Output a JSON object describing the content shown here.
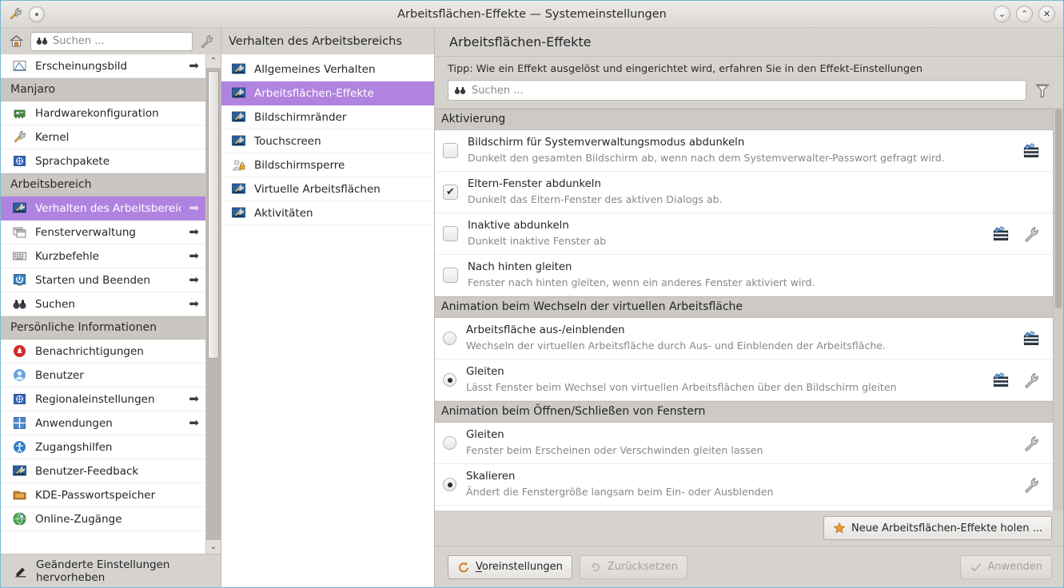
{
  "window": {
    "title": "Arbeitsflächen-Effekte — Systemeinstellungen",
    "minimize_label": "⌄",
    "maximize_label": "⌃",
    "close_label": "✕",
    "accent_color": "#b183e0",
    "window_bg": "#d6d2ce"
  },
  "sidebar": {
    "search": {
      "placeholder": "Suchen ...",
      "value": ""
    },
    "home_icon": "home-icon",
    "configure_icon": "wrench-icon",
    "top_item": {
      "label": "Erscheinungsbild",
      "icon": "appearance-icon",
      "has_arrow": true
    },
    "groups": [
      {
        "title": "Manjaro",
        "items": [
          {
            "label": "Hardwarekonfiguration",
            "icon": "hardware-icon",
            "has_arrow": false
          },
          {
            "label": "Kernel",
            "icon": "kernel-icon",
            "has_arrow": false
          },
          {
            "label": "Sprachpakete",
            "icon": "language-icon",
            "has_arrow": false
          }
        ]
      },
      {
        "title": "Arbeitsbereich",
        "items": [
          {
            "label": "Verhalten des Arbeitsbereichs",
            "icon": "workspace-icon",
            "has_arrow": true,
            "selected": true
          },
          {
            "label": "Fensterverwaltung",
            "icon": "window-icon",
            "has_arrow": true
          },
          {
            "label": "Kurzbefehle",
            "icon": "keyboard-icon",
            "has_arrow": true
          },
          {
            "label": "Starten und Beenden",
            "icon": "power-icon",
            "has_arrow": true
          },
          {
            "label": "Suchen",
            "icon": "search-icon",
            "has_arrow": true
          }
        ]
      },
      {
        "title": "Persönliche Informationen",
        "items": [
          {
            "label": "Benachrichtigungen",
            "icon": "bell-icon",
            "has_arrow": false
          },
          {
            "label": "Benutzer",
            "icon": "user-icon",
            "has_arrow": false
          },
          {
            "label": "Regionaleinstellungen",
            "icon": "globe-icon",
            "has_arrow": true
          },
          {
            "label": "Anwendungen",
            "icon": "applications-icon",
            "has_arrow": true
          },
          {
            "label": "Zugangshilfen",
            "icon": "accessibility-icon",
            "has_arrow": false
          },
          {
            "label": "Benutzer-Feedback",
            "icon": "feedback-icon",
            "has_arrow": false
          },
          {
            "label": "KDE-Passwortspeicher",
            "icon": "wallet-icon",
            "has_arrow": false
          },
          {
            "label": "Online-Zugänge",
            "icon": "online-accounts-icon",
            "has_arrow": false
          }
        ]
      }
    ],
    "footer": {
      "label": "Geänderte Einstellungen hervorheben",
      "icon": "highlight-pen-icon"
    }
  },
  "middle": {
    "header": "Verhalten des Arbeitsbereichs",
    "items": [
      {
        "label": "Allgemeines Verhalten",
        "icon": "workspace-icon",
        "selected": false
      },
      {
        "label": "Arbeitsflächen-Effekte",
        "icon": "workspace-icon",
        "selected": true
      },
      {
        "label": "Bildschirmränder",
        "icon": "workspace-icon",
        "selected": false
      },
      {
        "label": "Touchscreen",
        "icon": "workspace-icon",
        "selected": false
      },
      {
        "label": "Bildschirmsperre",
        "icon": "screenlock-icon",
        "selected": false
      },
      {
        "label": "Virtuelle Arbeitsflächen",
        "icon": "workspace-icon",
        "selected": false
      },
      {
        "label": "Aktivitäten",
        "icon": "workspace-icon",
        "selected": false
      }
    ]
  },
  "main": {
    "title": "Arbeitsflächen-Effekte",
    "tip": "Tipp: Wie ein Effekt ausgelöst und eingerichtet wird, erfahren Sie in den Effekt-Einstellungen",
    "search": {
      "placeholder": "Suchen ...",
      "value": ""
    },
    "filter_icon": "filter-funnel-icon",
    "sections": [
      {
        "title": "Aktivierung",
        "control_type": "checkbox",
        "rows": [
          {
            "title": "Bildschirm für Systemverwaltungsmodus abdunkeln",
            "desc": "Dunkelt den gesamten Bildschirm ab, wenn nach dem Systemverwalter-Passwort gefragt wird.",
            "checked": false,
            "actions": [
              "video-icon"
            ]
          },
          {
            "title": "Eltern-Fenster abdunkeln",
            "desc": "Dunkelt das Eltern-Fenster des aktiven Dialogs ab.",
            "checked": true,
            "actions": []
          },
          {
            "title": "Inaktive abdunkeln",
            "desc": "Dunkelt inaktive Fenster ab",
            "checked": false,
            "actions": [
              "video-icon",
              "wrench-icon"
            ]
          },
          {
            "title": "Nach hinten gleiten",
            "desc": "Fenster nach hinten gleiten, wenn ein anderes Fenster aktiviert wird.",
            "checked": false,
            "actions": []
          }
        ]
      },
      {
        "title": "Animation beim Wechseln der virtuellen Arbeitsfläche",
        "control_type": "radio",
        "rows": [
          {
            "title": "Arbeitsfläche aus-/einblenden",
            "desc": "Wechseln der virtuellen Arbeitsfläche durch Aus- und Einblenden der Arbeitsfläche.",
            "checked": false,
            "actions": [
              "video-icon"
            ]
          },
          {
            "title": "Gleiten",
            "desc": "Lässt Fenster beim Wechsel von virtuellen Arbeitsflächen über den Bildschirm gleiten",
            "checked": true,
            "actions": [
              "video-icon",
              "wrench-icon"
            ]
          }
        ]
      },
      {
        "title": "Animation beim Öffnen/Schließen von Fenstern",
        "control_type": "radio",
        "rows": [
          {
            "title": "Gleiten",
            "desc": "Fenster beim Erscheinen oder Verschwinden gleiten lassen",
            "checked": false,
            "actions": [
              "wrench-icon"
            ]
          },
          {
            "title": "Skalieren",
            "desc": "Ändert die Fenstergröße langsam beim Ein- oder Ausblenden",
            "checked": true,
            "actions": [
              "wrench-icon"
            ]
          }
        ]
      }
    ],
    "get_new_button": {
      "label": "Neue Arbeitsflächen-Effekte holen ...",
      "icon": "star-icon"
    }
  },
  "footer": {
    "defaults_button": {
      "label": "Voreinstellungen",
      "icon": "defaults-icon",
      "enabled": true
    },
    "reset_button": {
      "label": "Zurücksetzen",
      "icon": "undo-icon",
      "enabled": false
    },
    "apply_button": {
      "label": "Anwenden",
      "icon": "check-icon",
      "enabled": false
    }
  }
}
